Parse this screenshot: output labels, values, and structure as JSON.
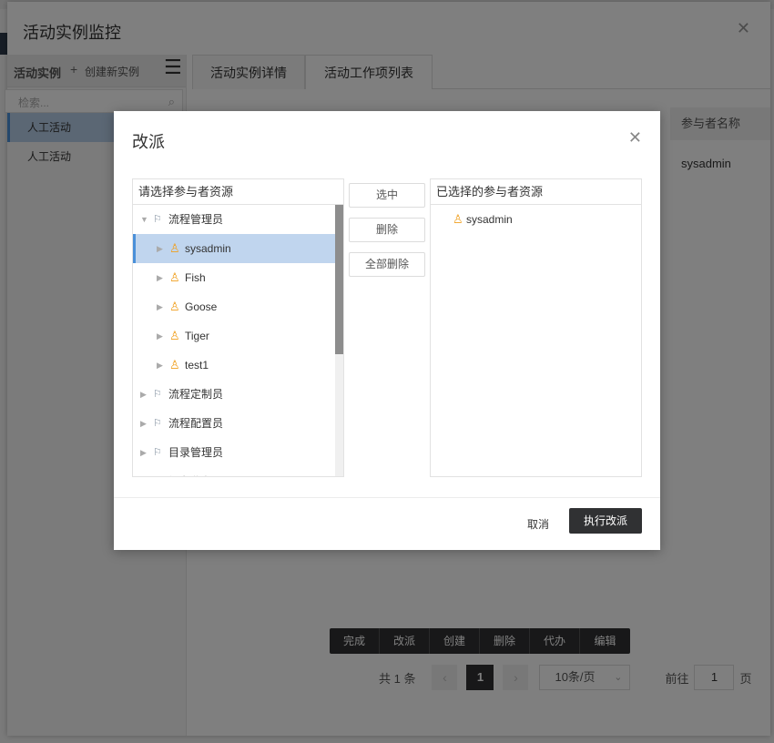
{
  "outer_dialog": {
    "title": "活动实例监控",
    "close_glyph": "✕",
    "left": {
      "header_title": "活动实例",
      "create_plus": "+",
      "create_label": "创建新实例",
      "menu_glyph": "☰",
      "search_placeholder": "检索...",
      "search_glyph": "⌕",
      "items": [
        "人工活动",
        "人工活动"
      ]
    },
    "tabs": [
      "活动实例详情",
      "活动工作项列表"
    ],
    "table": {
      "col_header": "参与者名称",
      "cell_value": "sysadmin"
    },
    "toolbar": [
      "完成",
      "改派",
      "创建",
      "删除",
      "代办",
      "编辑"
    ],
    "pager": {
      "total": "共 1 条",
      "prev_glyph": "‹",
      "current_page": "1",
      "next_glyph": "›",
      "page_size": "10条/页",
      "caret_glyph": "⌄",
      "goto_label": "前往",
      "goto_value": "1",
      "page_suffix": "页"
    }
  },
  "modal": {
    "title": "改派",
    "close_glyph": "✕",
    "left_panel_title": "请选择参与者资源",
    "right_panel_title": "已选择的参与者资源",
    "tree": [
      {
        "label": "流程管理员",
        "kind": "role",
        "expanded": true,
        "level": 0
      },
      {
        "label": "sysadmin",
        "kind": "user",
        "level": 1,
        "selected": true
      },
      {
        "label": "Fish",
        "kind": "user",
        "level": 1
      },
      {
        "label": "Goose",
        "kind": "user",
        "level": 1
      },
      {
        "label": "Tiger",
        "kind": "user",
        "level": 1
      },
      {
        "label": "test1",
        "kind": "user",
        "level": 1
      },
      {
        "label": "流程定制员",
        "kind": "role",
        "level": 0
      },
      {
        "label": "流程配置员",
        "kind": "role",
        "level": 0
      },
      {
        "label": "目录管理员",
        "kind": "role",
        "level": 0
      },
      {
        "label": "经办业务员",
        "kind": "role",
        "level": 0
      }
    ],
    "selected_list": [
      "sysadmin"
    ],
    "buttons": {
      "select": "选中",
      "delete": "删除",
      "delete_all": "全部删除",
      "cancel": "取消",
      "execute": "执行改派"
    },
    "icons": {
      "caret_expanded": "▼",
      "caret_collapsed": "▶",
      "role_glyph": "⚐",
      "user_glyph": "♙"
    }
  }
}
